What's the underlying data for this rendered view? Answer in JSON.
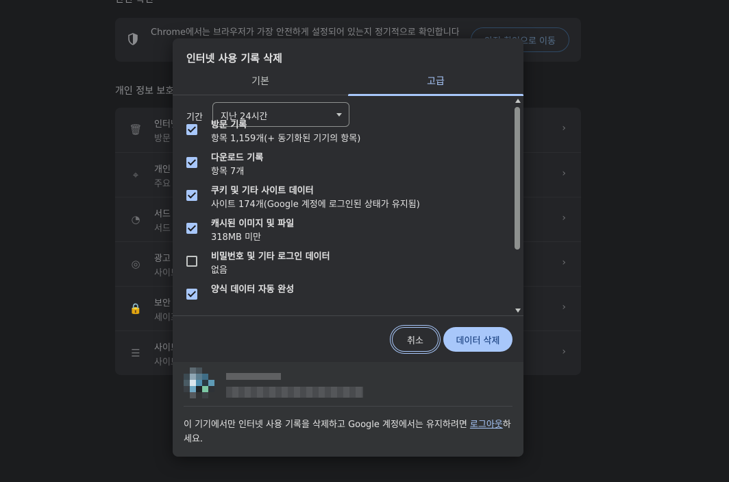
{
  "background": {
    "safety_section_title": "안전 확인",
    "safety_text": "Chrome에서는 브라우저가 가장 안전하게 설정되어 있는지 정기적으로 확인합니다",
    "safety_button": "안전 확인으로 이동",
    "privacy_section_title": "개인 정보 보호 및 보안",
    "rows": [
      {
        "icon": "trash-icon",
        "glyph": "🗑",
        "title": "인터넷 사용 기록 삭제",
        "subtitle": "방문 기록, 쿠키, 캐시 등 삭제"
      },
      {
        "icon": "privacy-guide-icon",
        "glyph": "⌖",
        "title": "개인 정보 보호 가이드",
        "subtitle": "주요 개인 정보 보호 및 보안 설정 검토"
      },
      {
        "icon": "cookie-icon",
        "glyph": "◔",
        "title": "서드 파티 쿠키",
        "subtitle": "서드 파티 쿠키가 시크릿 모드에서 차단됨"
      },
      {
        "icon": "ad-privacy-icon",
        "glyph": "◎",
        "title": "광고 개인 정보 보호",
        "subtitle": "사이트에서 광고를 표시하는 데 사용하는 정보를 맞춤설정합니다"
      },
      {
        "icon": "lock-icon",
        "glyph": "🔒",
        "title": "보안",
        "subtitle": "세이프 브라우징(위험한 사이트로부터 보호) 및 기타 보안 설정"
      },
      {
        "icon": "tune-icon",
        "glyph": "☰",
        "title": "사이트 설정",
        "subtitle": "사이트에서 사용하고 표시할 수 있는 정보 제어"
      }
    ]
  },
  "dialog": {
    "title": "인터넷 사용 기록 삭제",
    "tabs": [
      {
        "label": "기본",
        "active": false
      },
      {
        "label": "고급",
        "active": true
      }
    ],
    "time_range": {
      "label": "기간",
      "value": "지난 24시간"
    },
    "items": [
      {
        "name": "방문 기록",
        "desc": "항목 1,159개(+ 동기화된 기기의 항목)",
        "checked": true
      },
      {
        "name": "다운로드 기록",
        "desc": "항목 7개",
        "checked": true
      },
      {
        "name": "쿠키 및 기타 사이트 데이터",
        "desc": "사이트 174개(Google 계정에 로그인된 상태가 유지됨)",
        "checked": true
      },
      {
        "name": "캐시된 이미지 및 파일",
        "desc": "318MB 미만",
        "checked": true
      },
      {
        "name": "비밀번호 및 기타 로그인 데이터",
        "desc": "없음",
        "checked": false
      },
      {
        "name": "양식 데이터 자동 완성",
        "desc": "",
        "checked": true
      }
    ],
    "buttons": {
      "cancel": "취소",
      "delete": "데이터 삭제"
    },
    "footer": {
      "text_before": "이 기기에서만 인터넷 사용 기록을 삭제하고 Google 계정에서는 유지하려면 ",
      "link": "로그아웃",
      "text_after": "하세요."
    }
  },
  "colors": {
    "accent": "#a8c7fa",
    "dialog_bg": "#2c2d30",
    "page_bg": "#1b1c1e"
  }
}
